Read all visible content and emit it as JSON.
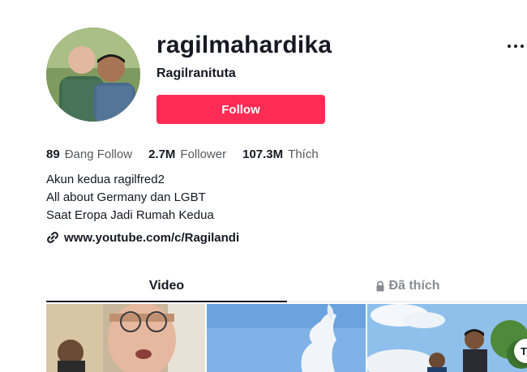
{
  "profile": {
    "username": "ragilmahardika",
    "nickname": "Ragilranituta",
    "avatar_icon": "avatar-photo",
    "follow_label": "Follow"
  },
  "stats": [
    {
      "value": "89",
      "label": "Đang Follow"
    },
    {
      "value": "2.7M",
      "label": "Follower"
    },
    {
      "value": "107.3M",
      "label": "Thích"
    }
  ],
  "bio": {
    "lines": [
      "Akun kedua ragilfred2",
      "All about Germany dan LGBT",
      "Saat Eropa Jadi Rumah Kedua"
    ],
    "link_icon": "link-icon",
    "link_text": "www.youtube.com/c/Ragilandi"
  },
  "tabs": {
    "video_label": "Video",
    "liked_label": "Đã thích",
    "liked_icon": "lock-icon"
  },
  "floating_button": {
    "label": "T"
  },
  "colors": {
    "follow_button": "#fe2c55",
    "text_primary": "#161823",
    "text_secondary": "#57585e",
    "tab_inactive": "#8a8b91",
    "divider": "#e3e3e4"
  }
}
